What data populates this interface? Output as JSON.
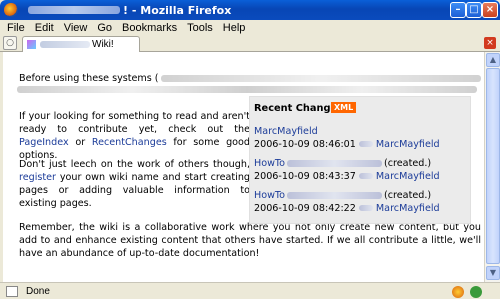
{
  "window": {
    "title_prefix": "",
    "title_suffix": "! - Mozilla Firefox"
  },
  "menu": [
    "File",
    "Edit",
    "View",
    "Go",
    "Bookmarks",
    "Tools",
    "Help"
  ],
  "tab": {
    "label_suffix": "Wiki!"
  },
  "content": {
    "intro": "Before using these systems (",
    "para1_a": "If your looking for something to read and aren't ready to contribute yet, check out the ",
    "para1_link1": "PageIndex",
    "para1_b": " or ",
    "para1_link2": "RecentChanges",
    "para1_c": " for some good options.",
    "para2_a": "Don't just leech on the work of others though, ",
    "para2_link": "register",
    "para2_b": " your own wiki name and start creating pages or adding valuable information to existing pages.",
    "para3": "Remember, the wiki is a collaborative work where you not only create new content, but you add to and enhance existing content that others have started. If we all contribute a little, we'll have an abundance of up-to-date documentation!"
  },
  "recent_changes": {
    "title": "Recent Changes",
    "badge": "XML",
    "entries": [
      {
        "title": "MarcMayfield",
        "title_suffix": "",
        "date": "2006-10-09 08:46:01",
        "author": "MarcMayfield"
      },
      {
        "title": "HowTo",
        "title_suffix": "(created.)",
        "date": "2006-10-09 08:43:37",
        "author": "MarcMayfield"
      },
      {
        "title": "HowTo",
        "title_suffix": "(created.)",
        "date": "2006-10-09 08:42:22",
        "author": "MarcMayfield"
      }
    ]
  },
  "status": {
    "text": "Done"
  }
}
